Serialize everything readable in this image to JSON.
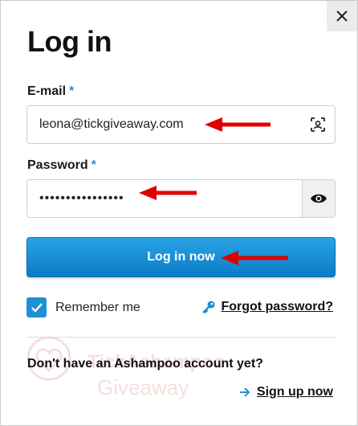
{
  "title": "Log in",
  "close_glyph": "✕",
  "email": {
    "label": "E-mail",
    "required_mark": "*",
    "value": "leona@tickgiveaway.com",
    "icon": "face-scan-icon"
  },
  "password": {
    "label": "Password",
    "required_mark": "*",
    "value": "••••••••••••••••",
    "icon": "eye-icon"
  },
  "login_button": {
    "label": "Log in now"
  },
  "remember": {
    "label": "Remember me",
    "checked": true
  },
  "forgot": {
    "label": "Forgot password?",
    "icon": "key-icon"
  },
  "signup_prompt": "Don't have an Ashampoo account yet?",
  "signup": {
    "label": "Sign up now",
    "icon": "arrow-right-icon"
  },
  "watermark": {
    "line1": "TickAshampoo",
    "line2": "Giveaway"
  },
  "colors": {
    "accent": "#1f8fd6",
    "button_top": "#2aa3e6",
    "button_bottom": "#0b7cc6",
    "annotation_arrow": "#e00000"
  }
}
